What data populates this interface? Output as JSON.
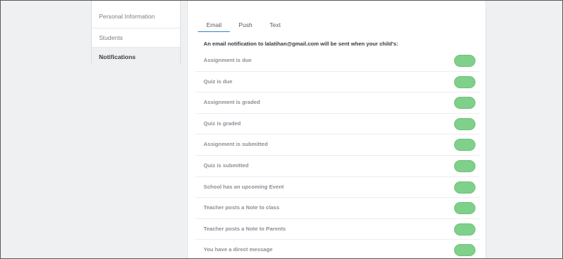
{
  "sidebar": {
    "items": [
      {
        "label": "Personal Information",
        "active": false
      },
      {
        "label": "Students",
        "active": false
      },
      {
        "label": "Notifications",
        "active": true
      }
    ]
  },
  "tabs": [
    {
      "label": "Email",
      "active": true
    },
    {
      "label": "Push",
      "active": false
    },
    {
      "label": "Text",
      "active": false
    }
  ],
  "intro": "An email notification to lalatihan@gmail.com will be sent when your child's:",
  "notifications": [
    {
      "label": "Assignment is due",
      "enabled": true
    },
    {
      "label": "Quiz is due",
      "enabled": true
    },
    {
      "label": "Assignment is graded",
      "enabled": true
    },
    {
      "label": "Quiz is graded",
      "enabled": true
    },
    {
      "label": "Assignment is submitted",
      "enabled": true
    },
    {
      "label": "Quiz is submitted",
      "enabled": true
    },
    {
      "label": "School has an upcoming Event",
      "enabled": true
    },
    {
      "label": "Teacher posts a Note to class",
      "enabled": true
    },
    {
      "label": "Teacher posts a Note to Parents",
      "enabled": true
    },
    {
      "label": "You have a direct message",
      "enabled": true
    }
  ],
  "colors": {
    "toggle_on": "#7fd08a",
    "tab_underline": "#2f87d6"
  }
}
